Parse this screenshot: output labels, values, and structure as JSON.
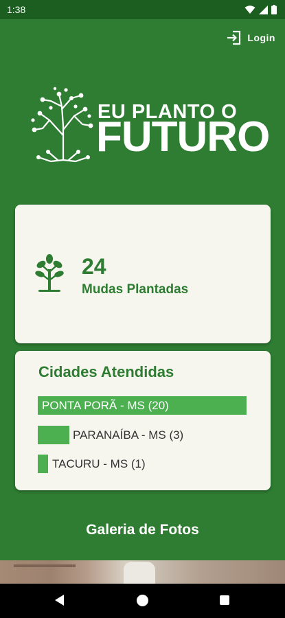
{
  "status_bar": {
    "time": "1:38",
    "icons": [
      "wifi-icon",
      "signal-icon",
      "battery-icon"
    ]
  },
  "header": {
    "login_label": "Login",
    "login_icon": "login-icon"
  },
  "logo": {
    "line1": "EU PLANTO O",
    "line2": "FUTURO",
    "icon": "tree-logo-icon"
  },
  "stats": {
    "count": "24",
    "label": "Mudas Plantadas",
    "icon": "sapling-icon"
  },
  "cities": {
    "title": "Cidades Atendidas",
    "items": [
      {
        "label": "PONTA PORÃ - MS (20)",
        "count": 20,
        "share": 1.0
      },
      {
        "label": "PARANAÍBA - MS (3)",
        "count": 3,
        "share": 0.15
      },
      {
        "label": "TACURU - MS (1)",
        "count": 1,
        "share": 0.05
      }
    ]
  },
  "gallery": {
    "title": "Galeria de Fotos"
  },
  "colors": {
    "primary": "#2e7d32",
    "accent": "#4caf50",
    "card": "#f6f6ef",
    "status_bar": "#1b5e20"
  },
  "nav": {
    "icons": [
      "back-icon",
      "home-icon",
      "recents-icon"
    ]
  }
}
